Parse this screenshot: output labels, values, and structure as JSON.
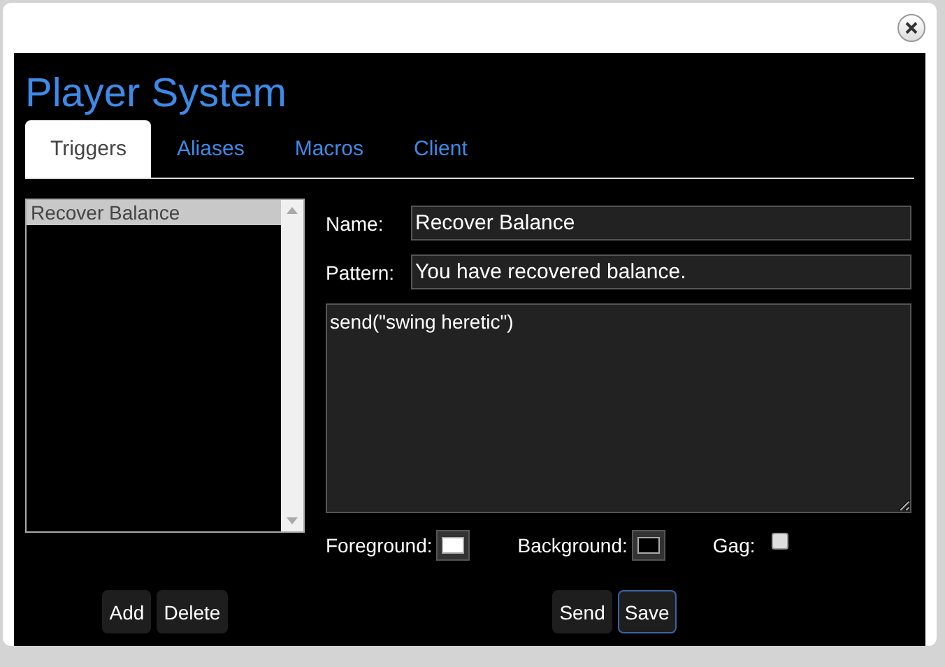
{
  "title": "Player System",
  "tabs": [
    {
      "label": "Triggers",
      "selected": true
    },
    {
      "label": "Aliases",
      "selected": false
    },
    {
      "label": "Macros",
      "selected": false
    },
    {
      "label": "Client",
      "selected": false
    }
  ],
  "trigger_list": {
    "items": [
      {
        "label": "Recover Balance",
        "selected": true
      }
    ]
  },
  "list_buttons": [
    {
      "label": "Add",
      "focused": false
    },
    {
      "label": "Delete",
      "focused": false
    }
  ],
  "form": {
    "name": {
      "label": "Name:",
      "value": "Recover Balance"
    },
    "pattern": {
      "label": "Pattern:",
      "value": "You have recovered balance."
    },
    "script": "send(\"swing heretic\")",
    "foreground": {
      "label": "Foreground:",
      "color": "#ffffff"
    },
    "background": {
      "label": "Background:",
      "color": "#000000"
    },
    "gag": {
      "label": "Gag:",
      "checked": false
    }
  },
  "form_buttons": [
    {
      "label": "Send",
      "focused": false
    },
    {
      "label": "Save",
      "focused": true
    }
  ]
}
